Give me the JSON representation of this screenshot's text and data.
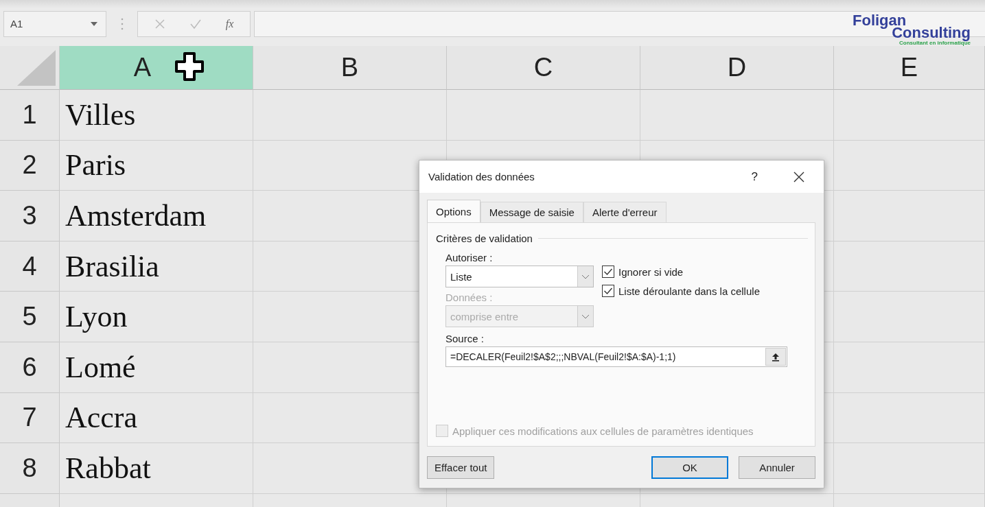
{
  "name_box": {
    "value": "A1"
  },
  "formula_bar": {
    "function_label": "fx"
  },
  "logo": {
    "line1": "Foligan",
    "line2": "Consulting",
    "tagline": "Consultant en informatique"
  },
  "columns": [
    {
      "label": "A",
      "selected": true
    },
    {
      "label": "B",
      "selected": false
    },
    {
      "label": "C",
      "selected": false
    },
    {
      "label": "D",
      "selected": false
    },
    {
      "label": "E",
      "selected": false
    }
  ],
  "rows": [
    {
      "number": "1",
      "value": "Villes"
    },
    {
      "number": "2",
      "value": "Paris"
    },
    {
      "number": "3",
      "value": "Amsterdam"
    },
    {
      "number": "4",
      "value": "Brasilia"
    },
    {
      "number": "5",
      "value": "Lyon"
    },
    {
      "number": "6",
      "value": "Lomé"
    },
    {
      "number": "7",
      "value": "Accra"
    },
    {
      "number": "8",
      "value": "Rabbat"
    }
  ],
  "dialog": {
    "title": "Validation des données",
    "help": "?",
    "tabs": [
      {
        "label": "Options",
        "selected": true
      },
      {
        "label": "Message de saisie",
        "selected": false
      },
      {
        "label": "Alerte d'erreur",
        "selected": false
      }
    ],
    "group_title": "Critères de validation",
    "allow": {
      "label": "Autoriser :",
      "value": "Liste",
      "disabled": false
    },
    "data": {
      "label": "Données :",
      "value": "comprise entre",
      "disabled": true
    },
    "checkboxes": [
      {
        "label": "Ignorer si vide",
        "checked": true
      },
      {
        "label": "Liste déroulante dans la cellule",
        "checked": true
      }
    ],
    "source": {
      "label": "Source :",
      "value": "=DECALER(Feuil2!$A$2;;;NBVAL(Feuil2!$A:$A)-1;1)"
    },
    "apply_all": {
      "label": "Appliquer ces modifications aux cellules de paramètres identiques",
      "checked": false,
      "disabled": true
    },
    "buttons": [
      {
        "label": "Effacer tout",
        "default": false
      },
      {
        "label": "OK",
        "default": true
      },
      {
        "label": "Annuler",
        "default": false
      }
    ]
  }
}
